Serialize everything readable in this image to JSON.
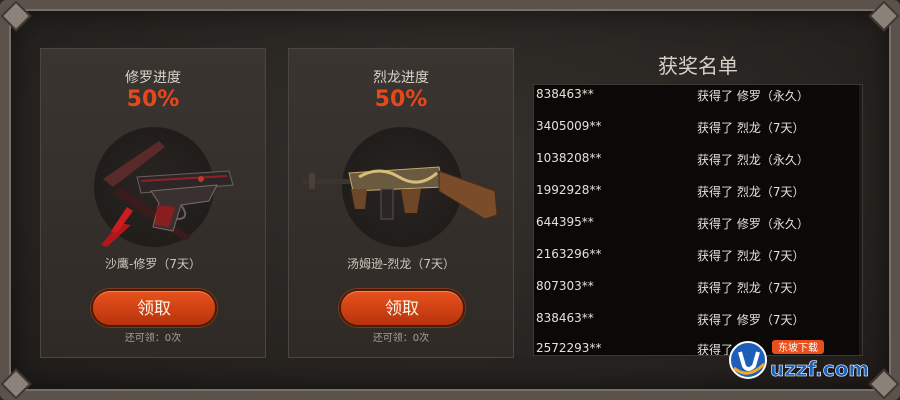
{
  "cards": [
    {
      "title": "修罗进度",
      "percent": "50%",
      "progress_fraction": 0.5,
      "weapon_name": "沙鹰-修罗（7天）",
      "button_label": "领取",
      "remaining": "还可领：0次"
    },
    {
      "title": "烈龙进度",
      "percent": "50%",
      "progress_fraction": 0.5,
      "weapon_name": "汤姆逊-烈龙（7天）",
      "button_label": "领取",
      "remaining": "还可领：0次"
    }
  ],
  "winners": {
    "title": "获奖名单",
    "rows": [
      {
        "uid": "838463**",
        "msg": "获得了 修罗（永久）"
      },
      {
        "uid": "3405009**",
        "msg": "获得了 烈龙（7天）"
      },
      {
        "uid": "1038208**",
        "msg": "获得了 烈龙（永久）"
      },
      {
        "uid": "1992928**",
        "msg": "获得了 烈龙（7天）"
      },
      {
        "uid": "644395**",
        "msg": "获得了 修罗（永久）"
      },
      {
        "uid": "2163296**",
        "msg": "获得了 烈龙（7天）"
      },
      {
        "uid": "807303**",
        "msg": "获得了 烈龙（7天）"
      },
      {
        "uid": "838463**",
        "msg": "获得了 修罗（7天）"
      },
      {
        "uid": "2572293**",
        "msg": "获得了"
      }
    ]
  },
  "watermark": {
    "text": "uzzf.com",
    "sub": "东坡下载"
  },
  "colors": {
    "accent": "#e5481b",
    "button": "#d2431a",
    "background": "#2a2522"
  }
}
